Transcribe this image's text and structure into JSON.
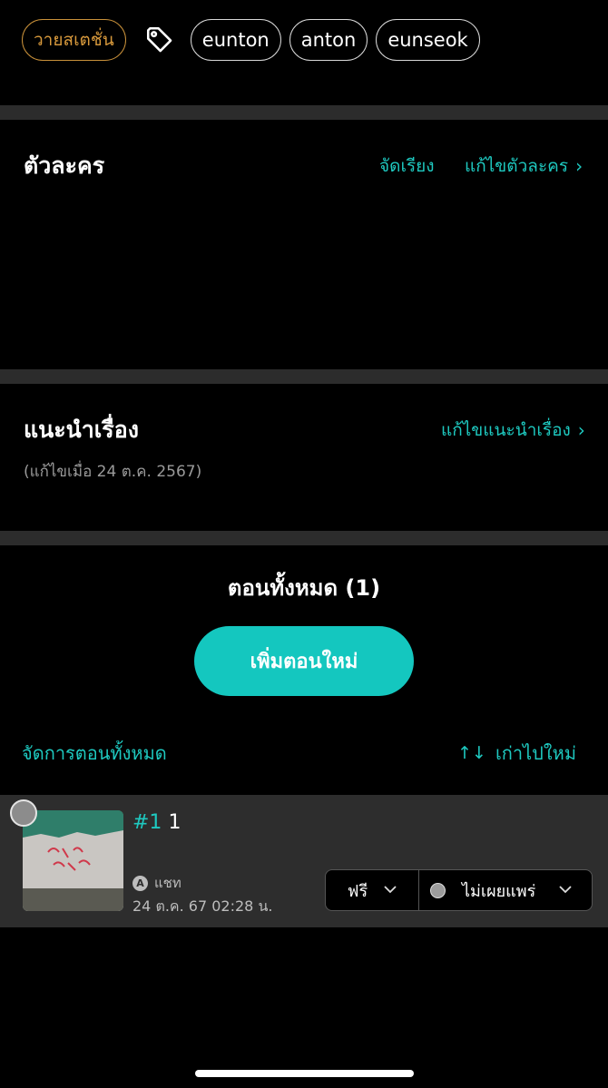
{
  "tags": {
    "status_label": "วายสเตชั่น",
    "items": [
      "eunton",
      "anton",
      "eunseok"
    ]
  },
  "characters": {
    "title": "ตัวละคร",
    "sort_label": "จัดเรียง",
    "edit_label": "แก้ไขตัวละคร"
  },
  "synopsis": {
    "title": "แนะนำเรื่อง",
    "edit_label": "แก้ไขแนะนำเรื่อง",
    "edited_text": "(แก้ไขเมื่อ 24 ต.ค. 2567)"
  },
  "episodes": {
    "title": "ตอนทั้งหมด (1)",
    "add_button": "เพิ่มตอนใหม่",
    "manage_label": "จัดการตอนทั้งหมด",
    "sort_label": "เก่าไปใหม่",
    "list": [
      {
        "number": "#1",
        "title": "1",
        "type_badge": "A",
        "type": "แชท",
        "date": "24 ต.ค. 67 02:28 น.",
        "price": "ฟรี",
        "publish_status": "ไม่เผยแพร่"
      }
    ]
  },
  "colors": {
    "accent": "#1ec9c0",
    "status_tag": "#d99a3c",
    "divider": "#2c2c2c"
  }
}
